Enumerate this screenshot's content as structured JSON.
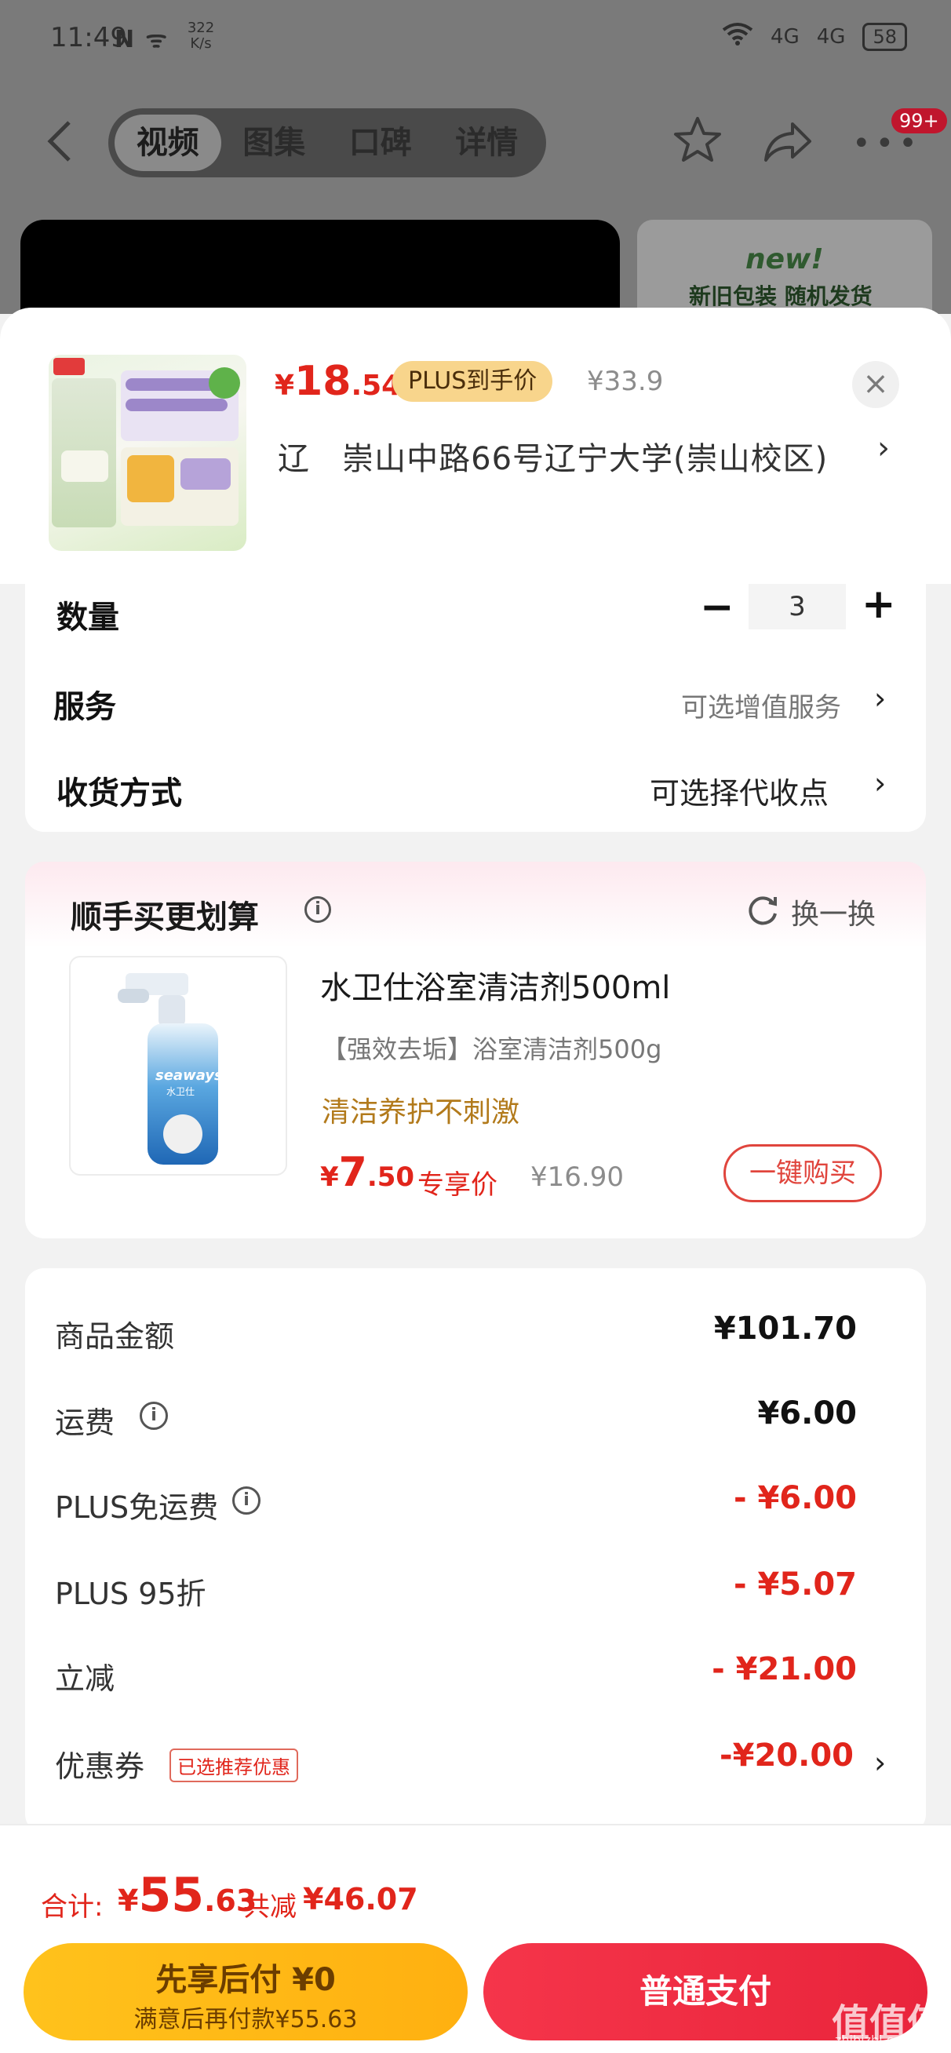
{
  "status_bar": {
    "time": "11:49",
    "net_icons": "N ᯤ",
    "speed_value": "322",
    "speed_unit": "K/s",
    "signal_1": "4G",
    "signal_2": "4G",
    "battery": "58"
  },
  "top_nav": {
    "tabs": [
      "视频",
      "图集",
      "口碑",
      "详情"
    ],
    "active_tab": "视频",
    "badge": "99+"
  },
  "background_thumb": {
    "new_label": "new!",
    "text": "新旧包装 随机发货"
  },
  "product": {
    "price_symbol": "¥",
    "price_int": "18",
    "price_dec": ".54",
    "plus_tag": "PLUS到手价",
    "original_price": "¥33.9",
    "address_prefix": "辽",
    "address": "崇山中路66号辽宁大学(崇山校区)"
  },
  "options": {
    "quantity_label": "数量",
    "quantity_value": "3",
    "service_label": "服务",
    "service_value": "可选增值服务",
    "delivery_label": "收货方式",
    "delivery_value": "可选择代收点"
  },
  "addon": {
    "title": "顺手买更划算",
    "refresh_label": "换一换",
    "name": "水卫仕浴室清洁剂500ml",
    "subtitle": "【强效去垢】浴室清洁剂500g",
    "tagline": "清洁养护不刺激",
    "price_symbol": "¥",
    "price_int": "7",
    "price_dec": ".50",
    "price_tag": "专享价",
    "original_price": "¥16.90",
    "buy_label": "一键购买",
    "image_brand": "seaways",
    "image_brand_cn": "水卫仕"
  },
  "summary": {
    "rows": [
      {
        "label": "商品金额",
        "value": "¥101.70"
      },
      {
        "label": "运费",
        "value": "¥6.00"
      },
      {
        "label": "PLUS免运费",
        "value": "- ¥6.00"
      },
      {
        "label": "PLUS 95折",
        "value": "- ¥5.07"
      },
      {
        "label": "立减",
        "value": "- ¥21.00"
      },
      {
        "label": "优惠券",
        "value": "-¥20.00"
      }
    ],
    "coupon_tag": "已选推荐优惠"
  },
  "bottom": {
    "total_label": "合计:",
    "total_symbol": "¥",
    "total_int": "55",
    "total_dec": ".63",
    "saved_label": "共减",
    "saved_value": "¥46.07",
    "pay_later_title": "先享后付 ¥0",
    "pay_later_sub": "满意后再付款¥55.63",
    "pay_normal": "普通支付"
  },
  "watermark": {
    "text": "值值值",
    "url": "zhibizhi.com"
  },
  "colors": {
    "accent_red": "#e1251b",
    "pay_yellow": "#ffc21c",
    "pay_red": "#f5354a",
    "plus_gold": "#f8d58c"
  }
}
